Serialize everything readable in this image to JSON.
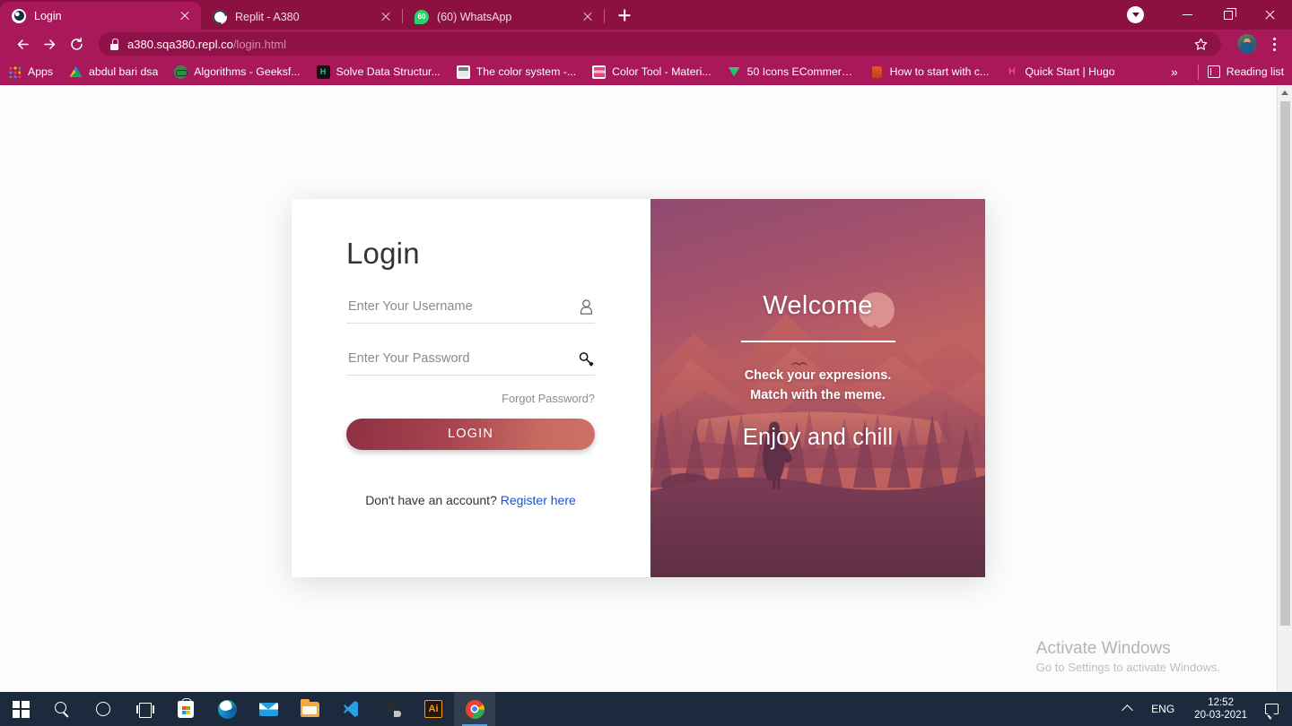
{
  "browser": {
    "tabs": [
      {
        "title": "Login",
        "favicon": "globe-icon",
        "active": true
      },
      {
        "title": "Replit - A380",
        "favicon": "replit-icon",
        "active": false
      },
      {
        "title": "(60) WhatsApp",
        "favicon": "whatsapp-icon",
        "active": false
      }
    ],
    "new_tab_label": "+",
    "window_controls": {
      "minimize": "—",
      "maximize": "□",
      "close": "×"
    },
    "omnibox": {
      "domain": "a380.sqa380.repl.co",
      "path": "/login.html",
      "secure": true
    },
    "bookmarks": [
      {
        "label": "Apps",
        "icon": "apps-grid-icon"
      },
      {
        "label": "abdul bari dsa",
        "icon": "google-drive-icon"
      },
      {
        "label": "Algorithms - Geeksf...",
        "icon": "geeksforgeeks-icon"
      },
      {
        "label": "Solve Data Structur...",
        "icon": "hackerrank-icon"
      },
      {
        "label": "The color system -...",
        "icon": "material-icon"
      },
      {
        "label": "Color Tool - Materi...",
        "icon": "color-tool-icon"
      },
      {
        "label": "50 Icons ECommerc...",
        "icon": "fifty-icons-icon"
      },
      {
        "label": "How to start with c...",
        "icon": "book-icon"
      },
      {
        "label": "Quick Start | Hugo",
        "icon": "hugo-icon"
      }
    ],
    "bookmarks_overflow": "»",
    "reading_list": "Reading list"
  },
  "login_card": {
    "title": "Login",
    "username": {
      "placeholder": "Enter Your Username",
      "value": "",
      "icon": "person-icon"
    },
    "password": {
      "placeholder": "Enter Your Password",
      "value": "",
      "icon": "key-icon"
    },
    "forgot_password": "Forgot Password?",
    "submit_label": "LOGIN",
    "register_prompt": "Don't have an account?",
    "register_link": "Register here",
    "accent_gradient_from": "#8e2f41",
    "accent_gradient_to": "#cf7067",
    "link_color": "#1a4fd6"
  },
  "welcome_panel": {
    "heading": "Welcome",
    "tagline_line1": "Check your expresions.",
    "tagline_line2": "Match with the meme.",
    "enjoy": "Enjoy and chill",
    "scene": "sunset-mountain-forest-illustration"
  },
  "watermark": {
    "title": "Activate Windows",
    "subtitle": "Go to Settings to activate Windows."
  },
  "taskbar": {
    "items": [
      {
        "name": "start-button",
        "icon": "windows-logo-icon"
      },
      {
        "name": "search-button",
        "icon": "search-icon"
      },
      {
        "name": "cortana-button",
        "icon": "cortana-circle-icon"
      },
      {
        "name": "task-view-button",
        "icon": "task-view-icon"
      },
      {
        "name": "microsoft-store",
        "icon": "microsoft-store-icon"
      },
      {
        "name": "microsoft-edge",
        "icon": "edge-icon"
      },
      {
        "name": "mail-app",
        "icon": "mail-icon"
      },
      {
        "name": "file-explorer",
        "icon": "folder-icon"
      },
      {
        "name": "vs-code",
        "icon": "vscode-icon"
      },
      {
        "name": "inkscape",
        "icon": "inkscape-icon"
      },
      {
        "name": "illustrator",
        "icon": "illustrator-icon",
        "label": "Ai"
      },
      {
        "name": "google-chrome",
        "icon": "chrome-icon",
        "active": true
      }
    ],
    "tray": {
      "language": "ENG",
      "time": "12:52",
      "date": "20-03-2021",
      "notifications_icon": "speech-bubble-icon",
      "chevron": "show-hidden-icons"
    }
  },
  "colors": {
    "titlebar": "#8c1040",
    "toolbar": "#a8185a",
    "taskbar": "#1b2a3c",
    "page_bg": "#fcfcfc"
  }
}
